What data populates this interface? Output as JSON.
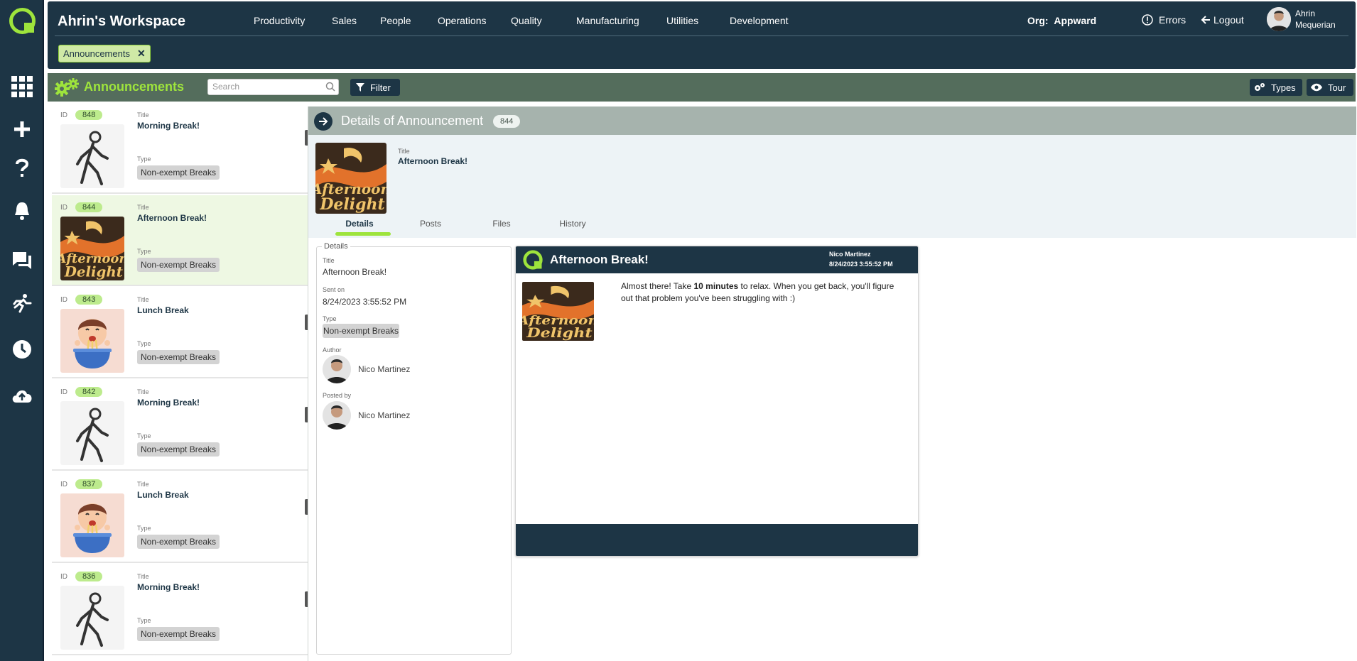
{
  "app": {
    "workspace_title": "Ahrin's Workspace",
    "nav": [
      "Productivity",
      "Sales",
      "People",
      "Operations",
      "Quality",
      "Manufacturing",
      "Utilities",
      "Development"
    ],
    "org_label": "Org:",
    "org_value": "Appward",
    "errors_label": "Errors",
    "logout_label": "Logout",
    "user_first": "Ahrin",
    "user_last": "Mequerian",
    "open_tab": "Announcements",
    "accent": "#9ee43c",
    "navy": "#1d3545"
  },
  "rail": {
    "icons": [
      "apps-grid-icon",
      "plus-icon",
      "help-icon",
      "bell-icon",
      "chat-icon",
      "runner-icon",
      "clock-icon",
      "cloud-upload-icon"
    ]
  },
  "module": {
    "title": "Announcements",
    "search_placeholder": "Search",
    "filter_label": "Filter",
    "types_label": "Types",
    "tour_label": "Tour"
  },
  "list": {
    "id_label": "ID",
    "title_label": "Title",
    "type_label": "Type",
    "items": [
      {
        "id": "848",
        "title": "Morning Break!",
        "type": "Non-exempt Breaks",
        "image": "walking"
      },
      {
        "id": "844",
        "title": "Afternoon Break!",
        "type": "Non-exempt Breaks",
        "image": "afternoon"
      },
      {
        "id": "843",
        "title": "Lunch Break",
        "type": "Non-exempt Breaks",
        "image": "noodles"
      },
      {
        "id": "842",
        "title": "Morning Break!",
        "type": "Non-exempt Breaks",
        "image": "walking"
      },
      {
        "id": "837",
        "title": "Lunch Break",
        "type": "Non-exempt Breaks",
        "image": "noodles"
      },
      {
        "id": "836",
        "title": "Morning Break!",
        "type": "Non-exempt Breaks",
        "image": "walking"
      }
    ]
  },
  "detail": {
    "heading": "Details of Announcement",
    "id": "844",
    "title_label": "Title",
    "title": "Afternoon Break!",
    "tabs": [
      "Details",
      "Posts",
      "Files",
      "History"
    ],
    "fieldset_legend": "Details",
    "fields": {
      "title_label": "Title",
      "title": "Afternoon Break!",
      "sent_label": "Sent on",
      "sent": "8/24/2023 3:55:52 PM",
      "type_label": "Type",
      "type": "Non-exempt Breaks",
      "author_label": "Author",
      "author": "Nico Martinez",
      "posted_label": "Posted by",
      "posted_by": "Nico Martinez"
    },
    "card": {
      "title": "Afternoon Break!",
      "author": "Nico Martinez",
      "date": "8/24/2023 3:55:52 PM",
      "msg_pre": "Almost there! Take ",
      "msg_bold": "10 minutes",
      "msg_post": " to relax. When you get back, you'll figure out that problem you've been struggling with :)"
    }
  }
}
